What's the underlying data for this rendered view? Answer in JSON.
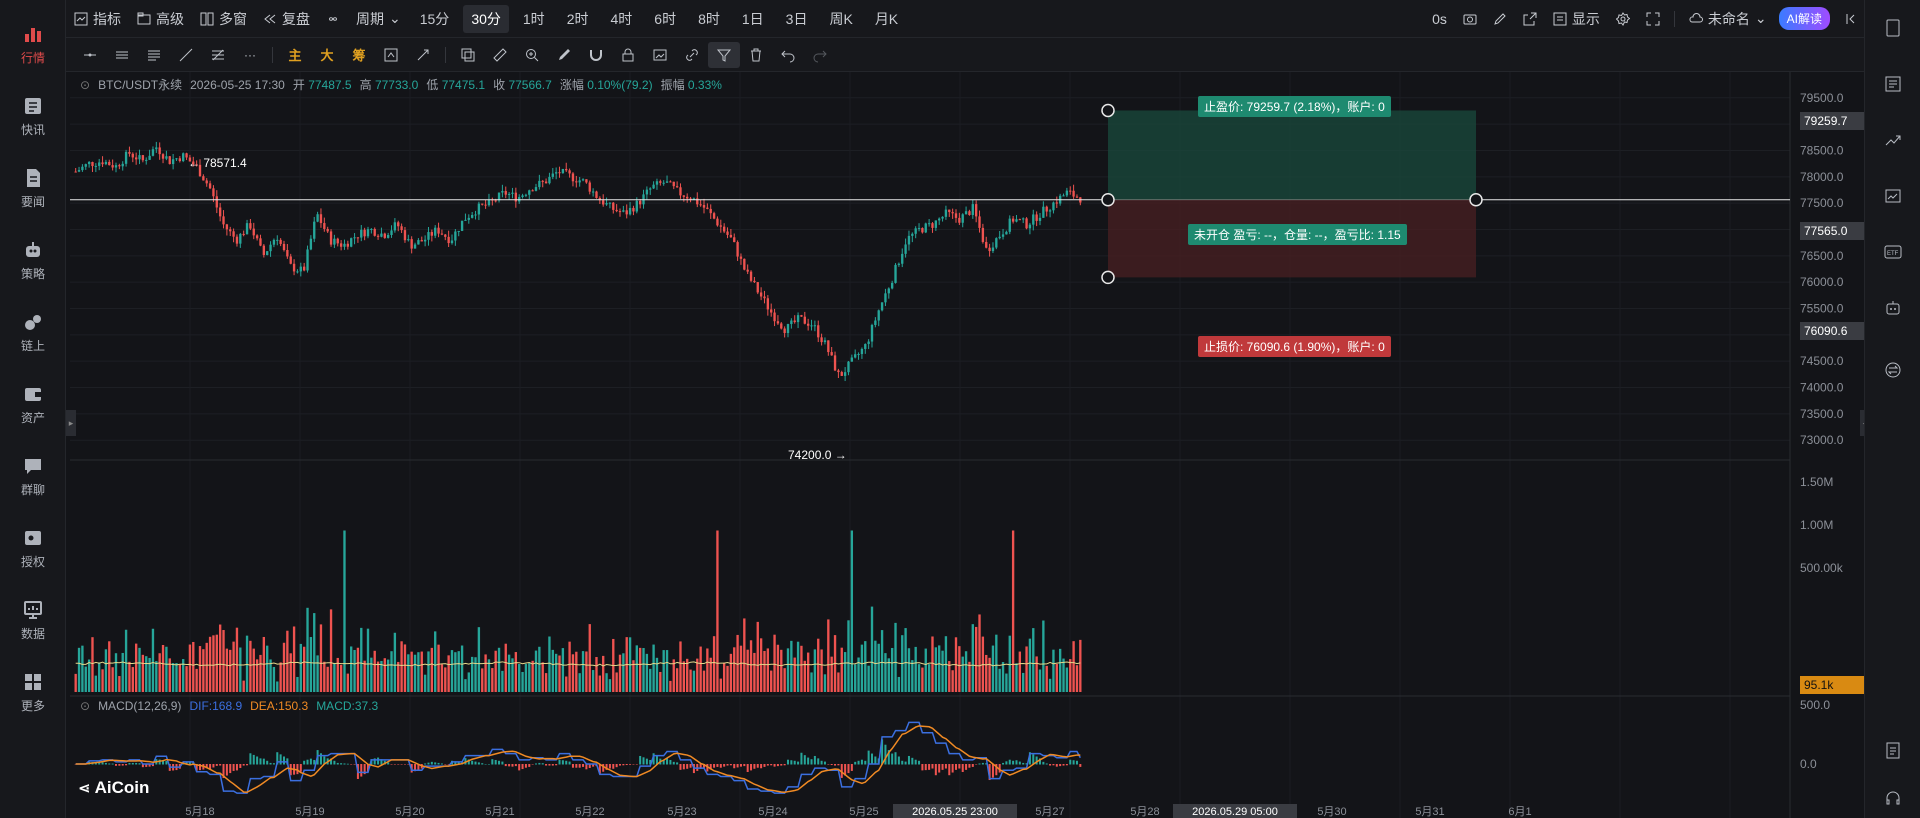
{
  "leftnav": [
    {
      "label": "行情",
      "icon": "bar-chart-icon",
      "active": true
    },
    {
      "label": "快讯",
      "icon": "flash-news-icon"
    },
    {
      "label": "要闻",
      "icon": "document-icon"
    },
    {
      "label": "策略",
      "icon": "robot-icon"
    },
    {
      "label": "链上",
      "icon": "chain-icon"
    },
    {
      "label": "资产",
      "icon": "wallet-icon"
    },
    {
      "label": "群聊",
      "icon": "chat-icon"
    },
    {
      "label": "授权",
      "icon": "key-icon"
    },
    {
      "label": "数据",
      "icon": "monitor-icon"
    },
    {
      "label": "更多",
      "icon": "grid-icon"
    }
  ],
  "topbar": {
    "indicator": "指标",
    "advanced": "高级",
    "multi": "多窗",
    "replay": "复盘",
    "period": "周期",
    "intervals": [
      "15分",
      "30分",
      "1时",
      "2时",
      "4时",
      "6时",
      "8时",
      "1日",
      "3日",
      "周K",
      "月K"
    ],
    "active_interval": "30分",
    "countdown": "0s",
    "display": "显示",
    "layout_name": "未命名",
    "ai": "AI解读"
  },
  "drawbar": {
    "main": "主",
    "big": "大",
    "chips": "筹"
  },
  "info": {
    "symbol": "BTC/USDT永续",
    "time": "2026-05-25 17:30",
    "open_label": "开",
    "open": "77487.5",
    "high_label": "高",
    "high": "77733.0",
    "low_label": "低",
    "low": "77475.1",
    "close_label": "收",
    "close": "77566.7",
    "chg_label": "涨幅",
    "chg": "0.10%(79.2)",
    "amp_label": "振幅",
    "amp": "0.33%"
  },
  "position": {
    "tp_text": "止盈价: 79259.7 (2.18%)，账户: 0",
    "sl_text": "止损价: 76090.6 (1.90%)，账户: 0",
    "mid_text": "未开仓 盈亏: --，仓量: --，盈亏比: 1.15",
    "tp_price": "79259.7",
    "entry_price": "77565.0",
    "sl_price": "76090.6"
  },
  "markers": {
    "high": "← 78571.4",
    "low": "74200.0 →"
  },
  "price_axis": [
    "79500.0",
    "79000.0",
    "78500.0",
    "78000.0",
    "77500.0",
    "77000.0",
    "76500.0",
    "76000.0",
    "75500.0",
    "75000.0",
    "74500.0",
    "74000.0",
    "73500.0",
    "73000.0"
  ],
  "volume_axis": [
    "1.50M",
    "1.00M",
    "500.00k"
  ],
  "volume_last": "95.1k",
  "macd": {
    "title": "MACD(12,26,9)",
    "dif": "DIF:168.9",
    "dea": "DEA:150.3",
    "macd": "MACD:37.3",
    "axis": [
      "500.0",
      "0.0"
    ]
  },
  "time_axis": [
    "5月18",
    "5月19",
    "5月20",
    "5月21",
    "5月22",
    "5月23",
    "5月24",
    "5月25",
    "2026.05.25 23:00",
    "5月27",
    "5月28",
    "2026.05.29 05:00",
    "5月30",
    "5月31",
    "6月1"
  ],
  "logo": "AiCoin",
  "colors": {
    "up": "#26a69a",
    "down": "#ef5350",
    "bg": "#131418",
    "tp": "#1e8a70",
    "sl": "#c0393b",
    "dif": "#3b6fe0",
    "dea": "#f08a24"
  },
  "chart_data": {
    "type": "candlestick",
    "price_range": [
      72700,
      79800
    ],
    "notable": {
      "high": 78571.4,
      "low": 74200.0,
      "last": 77565.0
    },
    "close_path": [
      78100,
      78250,
      78300,
      78200,
      78450,
      78300,
      78571.4,
      78300,
      78400,
      78200,
      77800,
      77100,
      76800,
      77100,
      76500,
      76900,
      76300,
      76200,
      77300,
      76800,
      76700,
      76900,
      77000,
      76900,
      77100,
      76700,
      76800,
      77000,
      76800,
      77200,
      77400,
      77500,
      77700,
      77600,
      77800,
      77900,
      78100,
      78000,
      77900,
      77600,
      77400,
      77300,
      77500,
      77800,
      77900,
      77700,
      77600,
      77400,
      77100,
      76800,
      76200,
      75800,
      75400,
      75100,
      75300,
      75200,
      74800,
      74200,
      74500,
      74800,
      75500,
      76100,
      76800,
      77000,
      77100,
      77300,
      77200,
      77400,
      76600,
      76900,
      77200,
      77100,
      77300,
      77500,
      77700,
      77600
    ],
    "volume_spike_index": [
      20,
      48,
      58,
      70,
      78
    ],
    "macd_histogram_shape": "oscillating"
  }
}
